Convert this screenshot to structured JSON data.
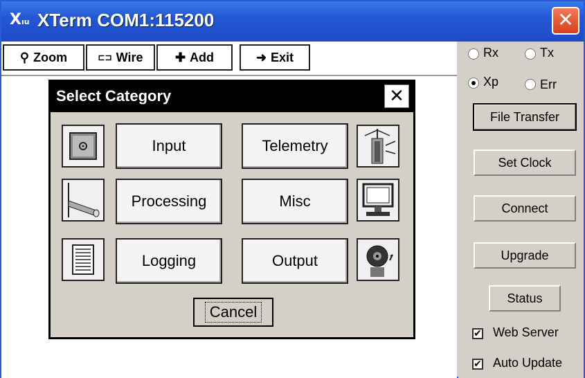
{
  "window": {
    "title": "XTerm COM1:115200",
    "logo_text": "X",
    "logo_small": "ıu",
    "close_glyph": "✕"
  },
  "toolbar": {
    "buttons": [
      {
        "label": "Zoom",
        "icon": "search-icon",
        "glyph": "⚲"
      },
      {
        "label": "Wire",
        "icon": "wire-icon",
        "glyph": "⊏⊐"
      },
      {
        "label": "Add",
        "icon": "plus-icon",
        "glyph": "✚"
      },
      {
        "label": "Exit",
        "icon": "arrow-right-icon",
        "glyph": "➜"
      }
    ]
  },
  "right_panel": {
    "radios": [
      {
        "label": "Rx",
        "selected": false
      },
      {
        "label": "Tx",
        "selected": false
      },
      {
        "label": "Xp",
        "selected": true
      },
      {
        "label": "Err",
        "selected": false
      }
    ],
    "buttons": [
      {
        "label": "File Transfer",
        "focused": true
      },
      {
        "label": "Set Clock",
        "focused": false
      },
      {
        "label": "Connect",
        "focused": false
      },
      {
        "label": "Upgrade",
        "focused": false
      },
      {
        "label": "Status",
        "focused": false
      }
    ],
    "checkboxes": [
      {
        "label": "Web Server",
        "checked": true,
        "mark": "✔"
      },
      {
        "label": "Auto Update",
        "checked": true,
        "mark": "✔"
      }
    ]
  },
  "dialog": {
    "title": "Select Category",
    "close_glyph": "✕",
    "categories": [
      {
        "label": "Input",
        "icon": "input-device-icon"
      },
      {
        "label": "Telemetry",
        "icon": "telemetry-tower-icon"
      },
      {
        "label": "Processing",
        "icon": "processing-icon"
      },
      {
        "label": "Misc",
        "icon": "computer-monitor-icon"
      },
      {
        "label": "Logging",
        "icon": "log-sheet-icon"
      },
      {
        "label": "Output",
        "icon": "alarm-bell-icon"
      }
    ],
    "cancel_label": "Cancel"
  }
}
